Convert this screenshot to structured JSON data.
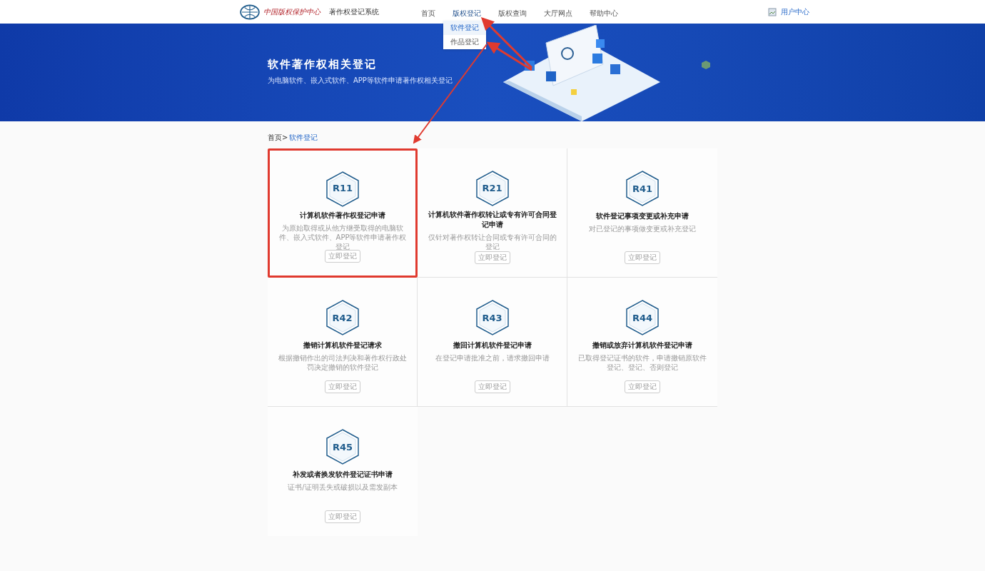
{
  "header": {
    "logo_text": "中国版权保护中心",
    "system_name": "著作权登记系统",
    "nav": [
      {
        "label": "首页",
        "selected": false
      },
      {
        "label": "版权登记",
        "selected": true
      },
      {
        "label": "版权查询",
        "selected": false
      },
      {
        "label": "大厅网点",
        "selected": false
      },
      {
        "label": "帮助中心",
        "selected": false
      }
    ],
    "dropdown": [
      {
        "label": "软件登记",
        "selected": true
      },
      {
        "label": "作品登记",
        "selected": false
      }
    ],
    "user_center": "用户中心"
  },
  "hero": {
    "title": "软件著作权相关登记",
    "subtitle": "为电脑软件、嵌入式软件、APP等软件申请著作权相关登记"
  },
  "breadcrumb": {
    "home": "首页>",
    "current": "软件登记"
  },
  "cards": [
    {
      "code": "R11",
      "title": "计算机软件著作权登记申请",
      "description": "为原始取得或从他方继受取得的电脑软件、嵌入式软件、APP等软件申请著作权登记",
      "button": "立即登记",
      "highlighted": true
    },
    {
      "code": "R21",
      "title": "计算机软件著作权转让或专有许可合同登记申请",
      "description": "仅针对著作权转让合同或专有许可合同的登记",
      "button": "立即登记",
      "highlighted": false
    },
    {
      "code": "R41",
      "title": "软件登记事项变更或补充申请",
      "description": "对已登记的事项做变更或补充登记",
      "button": "立即登记",
      "highlighted": false
    },
    {
      "code": "R42",
      "title": "撤销计算机软件登记请求",
      "description": "根据撤销作出的司法判决和著作权行政处罚决定撤销的软件登记",
      "button": "立即登记",
      "highlighted": false
    },
    {
      "code": "R43",
      "title": "撤回计算机软件登记申请",
      "description": "在登记申请批准之前，请求撤回申请",
      "button": "立即登记",
      "highlighted": false
    },
    {
      "code": "R44",
      "title": "撤销或放弃计算机软件登记申请",
      "description": "已取得登记证书的软件，申请撤销原软件登记、登记、否则登记",
      "button": "立即登记",
      "highlighted": false
    },
    {
      "code": "R45",
      "title": "补发或者换发软件登记证书申请",
      "description": "证书/证明丢失或破损以及需发副本",
      "button": "立即登记",
      "highlighted": false
    }
  ]
}
